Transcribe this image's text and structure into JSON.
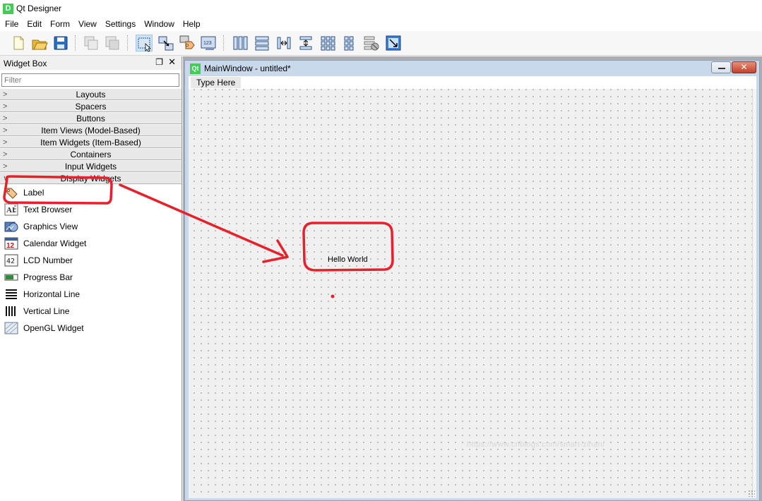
{
  "app": {
    "title": "Qt Designer",
    "icon_letter": "D"
  },
  "menu": [
    "File",
    "Edit",
    "Form",
    "View",
    "Settings",
    "Window",
    "Help"
  ],
  "toolbar": {
    "icons": [
      "new-form-icon",
      "open-form-icon",
      "save-form-icon",
      "cut-icon",
      "copy-icon",
      "edit-widgets-icon",
      "edit-signals-slots-icon",
      "edit-buddies-icon",
      "edit-tab-order-icon",
      "layout-horizontal-icon",
      "layout-vertical-icon",
      "layout-horizontal-splitter-icon",
      "layout-vertical-splitter-icon",
      "layout-grid-icon",
      "layout-form-icon",
      "break-layout-icon",
      "adjust-size-icon"
    ]
  },
  "widget_box": {
    "title": "Widget Box",
    "filter_placeholder": "Filter",
    "categories": [
      "Layouts",
      "Spacers",
      "Buttons",
      "Item Views (Model-Based)",
      "Item Widgets (Item-Based)",
      "Containers",
      "Input Widgets",
      "Display Widgets"
    ],
    "items": [
      {
        "label": "Label",
        "icon": "label-tag-icon"
      },
      {
        "label": "Text Browser",
        "icon": "text-browser-icon"
      },
      {
        "label": "Graphics View",
        "icon": "graphics-view-icon"
      },
      {
        "label": "Calendar Widget",
        "icon": "calendar-icon"
      },
      {
        "label": "LCD Number",
        "icon": "lcd-number-icon"
      },
      {
        "label": "Progress Bar",
        "icon": "progress-bar-icon"
      },
      {
        "label": "Horizontal Line",
        "icon": "horizontal-line-icon"
      },
      {
        "label": "Vertical Line",
        "icon": "vertical-line-icon"
      },
      {
        "label": "OpenGL Widget",
        "icon": "opengl-widget-icon"
      }
    ]
  },
  "subwindow": {
    "icon_letter": "Qt",
    "title": "MainWindow - untitled*",
    "menubar_placeholder": "Type Here",
    "label_text": "Hello World",
    "watermark": "https://www.cnblogs.com/smart-zihan/"
  },
  "colors": {
    "annotation": "#e8202a",
    "qt_green": "#41cd52",
    "selection": "#cce4f7"
  }
}
